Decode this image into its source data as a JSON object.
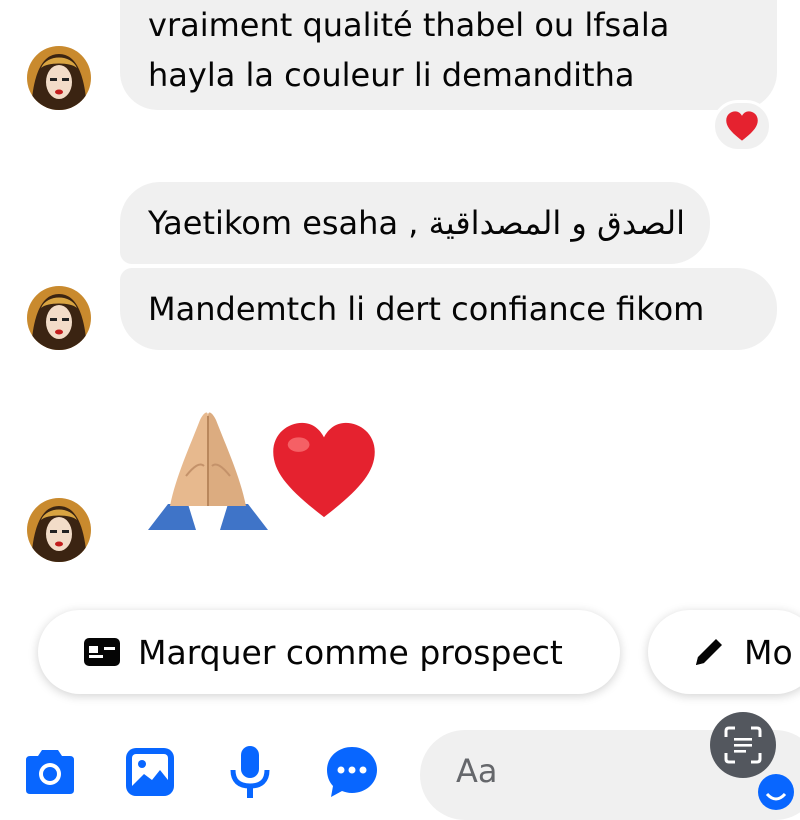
{
  "messages": [
    {
      "lines": [
        "vraiment qualité thabel ou lfsala",
        "hayla la couleur li demanditha"
      ]
    },
    {
      "text": "Yaetikom esaha , الصدق و المصداقية"
    },
    {
      "text": "Mandemtch li dert confiance fikom"
    }
  ],
  "reaction": {
    "icon": "red-heart"
  },
  "emoji_message": {
    "icons": [
      "folded-hands",
      "red-heart"
    ]
  },
  "quick_actions": [
    {
      "label": "Marquer comme prospect",
      "icon": "id-card-icon"
    },
    {
      "label": "Mo",
      "icon": "pencil-icon"
    }
  ],
  "composer": {
    "placeholder": "Aa"
  },
  "colors": {
    "accent": "#0866ff",
    "bubble": "#f0f0f0",
    "heart": "#e5222f"
  }
}
